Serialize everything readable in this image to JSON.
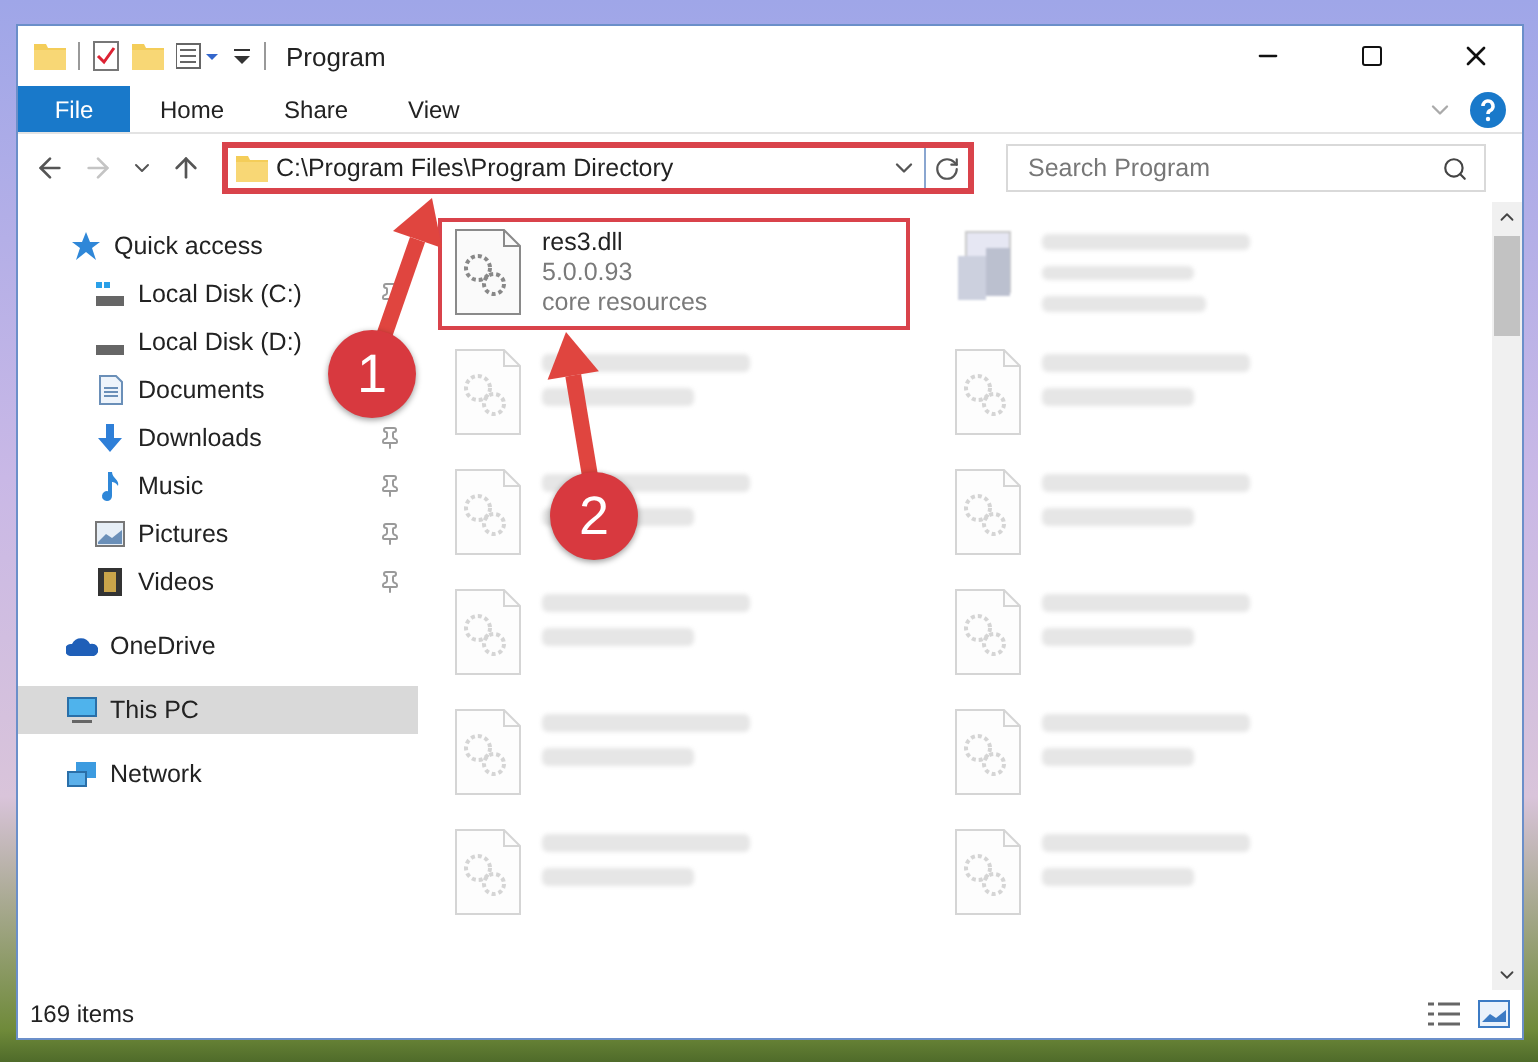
{
  "window": {
    "title": "Program"
  },
  "ribbon_tabs": [
    {
      "label": "File",
      "kind": "file"
    },
    {
      "label": "Home",
      "kind": "tab"
    },
    {
      "label": "Share",
      "kind": "tab"
    },
    {
      "label": "View",
      "kind": "tab"
    }
  ],
  "navigation": {
    "back_disabled": false,
    "forward_disabled": true
  },
  "address_bar": {
    "path": "C:\\Program Files\\Program Directory",
    "highlighted": true
  },
  "search": {
    "placeholder": "Search Program"
  },
  "sidebar": {
    "items": [
      {
        "label": "Quick access",
        "kind": "star",
        "selected": false,
        "children": [
          {
            "label": "Local Disk (C:)",
            "kind": "disk-c",
            "pinned": true,
            "selected": false
          },
          {
            "label": "Local Disk (D:)",
            "kind": "disk",
            "pinned": false,
            "selected": false
          },
          {
            "label": "Documents",
            "kind": "documents",
            "pinned": false,
            "selected": false
          },
          {
            "label": "Downloads",
            "kind": "downloads",
            "pinned": true,
            "selected": false
          },
          {
            "label": "Music",
            "kind": "music",
            "pinned": true,
            "selected": false
          },
          {
            "label": "Pictures",
            "kind": "pictures",
            "pinned": true,
            "selected": false
          },
          {
            "label": "Videos",
            "kind": "videos",
            "pinned": true,
            "selected": false
          }
        ]
      },
      {
        "label": "OneDrive",
        "kind": "cloud",
        "selected": false
      },
      {
        "label": "This PC",
        "kind": "pc",
        "selected": true
      },
      {
        "label": "Network",
        "kind": "network",
        "selected": false
      }
    ]
  },
  "files": [
    {
      "name": "res3.dll",
      "lines": [
        "5.0.0.93",
        "core resources"
      ],
      "kind": "dll",
      "highlighted": true
    },
    {
      "kind": "blurred-exe"
    },
    {
      "kind": "blurred-dll"
    },
    {
      "kind": "blurred-dll"
    },
    {
      "kind": "blurred-dll"
    },
    {
      "kind": "blurred-dll"
    },
    {
      "kind": "blurred-dll"
    },
    {
      "kind": "blurred-dll"
    },
    {
      "kind": "blurred-dll"
    },
    {
      "kind": "blurred-dll"
    },
    {
      "kind": "blurred-dll"
    },
    {
      "kind": "blurred-dll"
    }
  ],
  "status_bar": {
    "item_count": "169 items"
  },
  "annotations": [
    {
      "label": "1"
    },
    {
      "label": "2"
    }
  ]
}
